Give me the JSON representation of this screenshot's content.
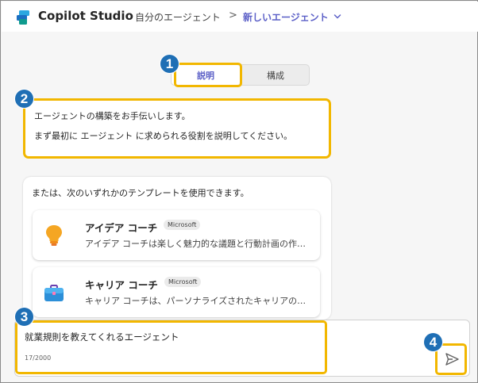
{
  "header": {
    "app_title": "Copilot Studio",
    "breadcrumb_agents": "自分のエージェント",
    "breadcrumb_separator": ">",
    "breadcrumb_current": "新しいエージェント"
  },
  "tabs": [
    {
      "label": "説明",
      "active": true
    },
    {
      "label": "構成",
      "active": false
    }
  ],
  "callouts": [
    "1",
    "2",
    "3",
    "4"
  ],
  "intro": {
    "line1": "エージェントの構築をお手伝いします。",
    "line2": "まず最初に エージェント に求められる役割を説明してください。"
  },
  "templates": {
    "intro": "または、次のいずれかのテンプレートを使用できます。",
    "items": [
      {
        "title": "アイデア コーチ",
        "badge": "Microsoft",
        "description": "アイデア コーチは楽しく魅力的な議題と行動計画の作成をサポートします",
        "icon": "lightbulb-icon"
      },
      {
        "title": "キャリア コーチ",
        "badge": "Microsoft",
        "description": "キャリア コーチは、パーソナライズされたキャリアのアドバイスを提供します",
        "icon": "briefcase-icon"
      }
    ]
  },
  "composer": {
    "value": "就業規則を教えてくれるエージェント",
    "char_count": "17/2000"
  },
  "colors": {
    "accent": "#5b5fc7",
    "highlight": "#f2b700",
    "badge": "#1f6fb5"
  }
}
